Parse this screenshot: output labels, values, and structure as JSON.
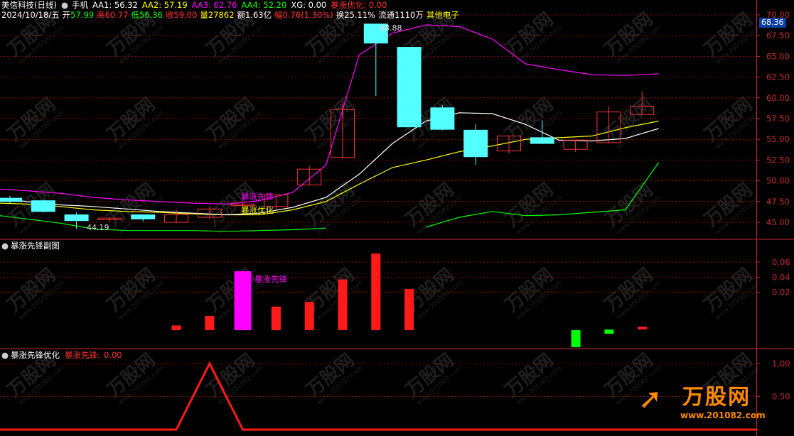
{
  "header": {
    "stock_name": "美信科技(日线)",
    "toolbar_item": "手机",
    "ma": [
      {
        "label": "AA1:",
        "value": "56.32",
        "color": "#ffffff"
      },
      {
        "label": "AA2:",
        "value": "57.19",
        "color": "#ffff00"
      },
      {
        "label": "AA3:",
        "value": "62.76",
        "color": "#ff00ff"
      },
      {
        "label": "AA4:",
        "value": "52.20",
        "color": "#00ff00"
      },
      {
        "label": "XG:",
        "value": "0.00",
        "color": "#ffffff"
      },
      {
        "label": "暴涨优化:",
        "value": "0.00",
        "color": "#ff3030"
      }
    ]
  },
  "info": {
    "date": "2024/10/18/五",
    "open_label": "开",
    "open": "57.99",
    "high_label": "高",
    "high": "60.77",
    "low_label": "低",
    "low": "56.36",
    "close_label": "收",
    "close": "59.00",
    "volume_label": "量",
    "volume": "27862",
    "amount_label": "额",
    "amount": "1.63亿",
    "change_label": "幅",
    "change": "0.76(1.30%)",
    "turnover_label": "换",
    "turnover": "25.11%",
    "float_label": "流通",
    "float": "1110万",
    "sector": "其他电子"
  },
  "colors": {
    "up": "#ff3232",
    "down": "#54ffff",
    "ma_white": "#ffffff",
    "ma_yellow": "#ffff00",
    "band_upper": "#ff00ff",
    "band_lower": "#00ff00",
    "grid": "#8b0000",
    "axis": "#c62a2a"
  },
  "main_axis": {
    "ticks": [
      "70.00",
      "67.50",
      "65.00",
      "62.50",
      "60.00",
      "57.50",
      "55.00",
      "52.50",
      "50.00",
      "47.50",
      "45.00"
    ],
    "current_price": "68.36",
    "ymin": 43.5,
    "ymax": 70.6
  },
  "annotations": {
    "high_label": "68.88",
    "low_label": "44.19",
    "signal_label": "暴涨先锋",
    "signal_label2": "暴涨优化"
  },
  "sub1": {
    "title": "暴涨先锋副图",
    "ticks": [
      "0.06",
      "0.04",
      "0.02"
    ],
    "bar_label": "暴涨先锋"
  },
  "sub2": {
    "title": "暴涨先锋优化",
    "param_label": "暴涨先锋:",
    "param_value": "0.00",
    "ticks": [
      "1.00",
      "0.50"
    ]
  },
  "watermark": {
    "brand": "万股网",
    "site": "www.201082.com"
  },
  "chart_data": {
    "type": "candlestick",
    "candles": [
      {
        "o": 47.9,
        "h": 48.2,
        "l": 47.3,
        "c": 47.5
      },
      {
        "o": 47.6,
        "h": 47.7,
        "l": 46.2,
        "c": 46.3
      },
      {
        "o": 45.9,
        "h": 46.2,
        "l": 44.2,
        "c": 45.2
      },
      {
        "o": 45.3,
        "h": 45.6,
        "l": 45.0,
        "c": 45.5
      },
      {
        "o": 45.9,
        "h": 45.9,
        "l": 45.1,
        "c": 45.4
      },
      {
        "o": 45.0,
        "h": 46.6,
        "l": 44.9,
        "c": 45.9
      },
      {
        "o": 45.6,
        "h": 46.9,
        "l": 45.4,
        "c": 46.6
      },
      {
        "o": 47.0,
        "h": 47.3,
        "l": 47.0,
        "c": 47.2
      },
      {
        "o": 46.9,
        "h": 48.3,
        "l": 46.6,
        "c": 48.3
      },
      {
        "o": 49.5,
        "h": 51.8,
        "l": 49.5,
        "c": 51.4
      },
      {
        "o": 52.8,
        "h": 59.6,
        "l": 52.8,
        "c": 58.6
      },
      {
        "o": 68.9,
        "h": 68.9,
        "l": 60.2,
        "c": 66.6
      },
      {
        "o": 66.1,
        "h": 64.2,
        "l": 56.5,
        "c": 56.5
      },
      {
        "o": 58.8,
        "h": 59.1,
        "l": 56.1,
        "c": 56.2
      },
      {
        "o": 56.1,
        "h": 56.8,
        "l": 51.9,
        "c": 52.9
      },
      {
        "o": 53.6,
        "h": 55.5,
        "l": 53.3,
        "c": 55.4
      },
      {
        "o": 55.2,
        "h": 57.3,
        "l": 54.5,
        "c": 54.5
      },
      {
        "o": 53.8,
        "h": 54.9,
        "l": 53.5,
        "c": 54.9
      },
      {
        "o": 54.6,
        "h": 59.0,
        "l": 54.5,
        "c": 58.3
      },
      {
        "o": 58.0,
        "h": 60.8,
        "l": 58.0,
        "c": 59.0
      }
    ],
    "ma_white": [
      47.9,
      47.5,
      47.1,
      46.9,
      46.6,
      46.3,
      46.1,
      45.9,
      46.1,
      46.8,
      48.0,
      50.8,
      54.5,
      57.2,
      58.2,
      58.1,
      56.8,
      54.9,
      54.8,
      55.1,
      56.3
    ],
    "ma_yellow": [
      47.3,
      47.2,
      46.9,
      46.5,
      46.3,
      46.2,
      46.0,
      45.9,
      45.9,
      46.5,
      47.5,
      49.6,
      51.6,
      52.5,
      53.5,
      54.2,
      55.0,
      55.2,
      55.4,
      56.4,
      57.2
    ],
    "band_upper": [
      49.0,
      48.8,
      48.5,
      48.0,
      47.7,
      47.5,
      47.3,
      47.2,
      47.6,
      48.6,
      51.9,
      65.2,
      67.8,
      68.8,
      68.6,
      67.1,
      64.1,
      63.4,
      62.8,
      62.7,
      62.9
    ],
    "band_lower": [
      45.8,
      45.4,
      44.9,
      44.2,
      44.0,
      44.0,
      44.0,
      43.9,
      44.0,
      44.1,
      44.3,
      null,
      null,
      44.4,
      45.6,
      46.3,
      45.8,
      45.9,
      46.2,
      46.5,
      52.2
    ],
    "sub1_values": [
      0.004,
      0.012,
      0.05,
      0.02,
      0.024,
      0.043,
      0.065,
      0.035,
      0,
      0,
      0,
      0,
      -0.022,
      0.006,
      0.004
    ],
    "sub1_index": [
      5,
      6,
      7,
      8,
      9,
      10,
      11,
      12,
      13,
      14,
      15,
      16,
      17,
      18,
      19
    ],
    "sub2_values": [
      0,
      0,
      0,
      0,
      0,
      0,
      1,
      0,
      0,
      0,
      0,
      0,
      0,
      0,
      0,
      0,
      0,
      0,
      0,
      0
    ]
  }
}
